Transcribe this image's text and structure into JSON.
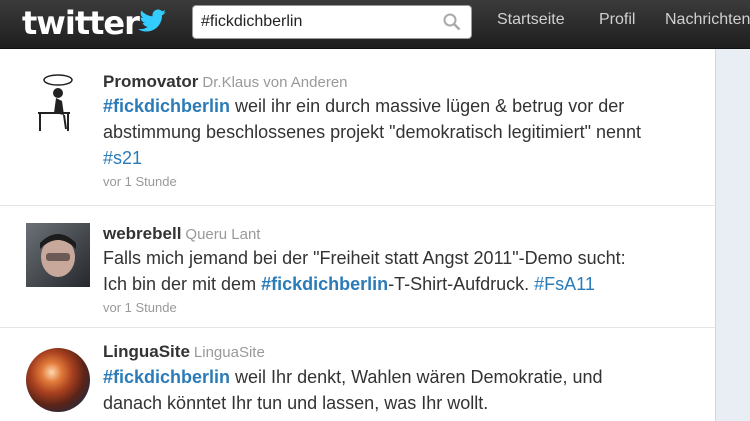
{
  "header": {
    "logo": "twitter",
    "search": {
      "value": "#fickdichberlin"
    },
    "nav": [
      "Startseite",
      "Profil",
      "Nachrichten"
    ]
  },
  "tweets": [
    {
      "screen_name": "Promovator",
      "real_name": "Dr.Klaus von Anderen",
      "text": {
        "line1_tag": "#fickdichberlin",
        "line1": " weil ihr ein durch massive lügen & betrug vor der",
        "line2": "abstimmung beschlossenes projekt \"demokratisch legitimiert\" nennt",
        "line3_tag": "#s21"
      },
      "time": "vor 1 Stunde"
    },
    {
      "screen_name": "webrebell",
      "real_name": "Queru Lant",
      "text": {
        "line1": "Falls mich jemand bei der \"Freiheit statt Angst 2011\"-Demo sucht:",
        "line2_pre": "Ich bin der mit dem ",
        "line2_tag": "#fickdichberlin",
        "line2_mid": "-T-Shirt-Aufdruck. ",
        "line2_tag2": "#FsA11"
      },
      "time": "vor 1 Stunde"
    },
    {
      "screen_name": "LinguaSite",
      "real_name": "LinguaSite",
      "text": {
        "line1_tag": "#fickdichberlin",
        "line1": " weil Ihr denkt, Wahlen wären Demokratie, und",
        "line2": "danach könntet Ihr tun und lassen, was Ihr wollt."
      }
    }
  ]
}
